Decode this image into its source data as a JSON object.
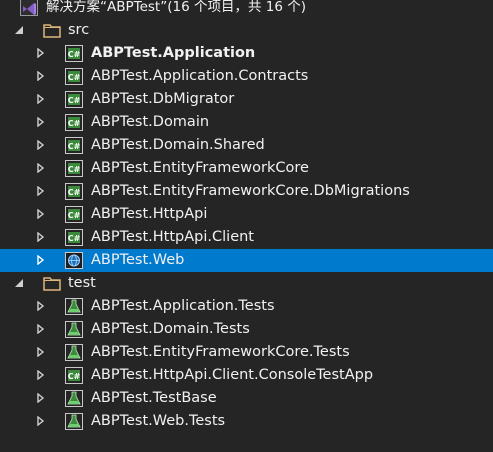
{
  "solution": {
    "label": "解决方案“ABPTest”(16 个项目，共 16 个)",
    "icon": "visual-studio-solution-icon"
  },
  "folders": [
    {
      "name": "src",
      "expanded": true,
      "icon": "folder-icon",
      "projects": [
        {
          "label": "ABPTest.Application",
          "icon": "csharp-project-icon",
          "bold": true
        },
        {
          "label": "ABPTest.Application.Contracts",
          "icon": "csharp-project-icon"
        },
        {
          "label": "ABPTest.DbMigrator",
          "icon": "csharp-project-icon"
        },
        {
          "label": "ABPTest.Domain",
          "icon": "csharp-project-icon"
        },
        {
          "label": "ABPTest.Domain.Shared",
          "icon": "csharp-project-icon"
        },
        {
          "label": "ABPTest.EntityFrameworkCore",
          "icon": "csharp-project-icon"
        },
        {
          "label": "ABPTest.EntityFrameworkCore.DbMigrations",
          "icon": "csharp-project-icon"
        },
        {
          "label": "ABPTest.HttpApi",
          "icon": "csharp-project-icon"
        },
        {
          "label": "ABPTest.HttpApi.Client",
          "icon": "csharp-project-icon"
        },
        {
          "label": "ABPTest.Web",
          "icon": "web-project-icon",
          "selected": true
        }
      ]
    },
    {
      "name": "test",
      "expanded": true,
      "icon": "folder-icon",
      "projects": [
        {
          "label": "ABPTest.Application.Tests",
          "icon": "test-project-icon"
        },
        {
          "label": "ABPTest.Domain.Tests",
          "icon": "test-project-icon"
        },
        {
          "label": "ABPTest.EntityFrameworkCore.Tests",
          "icon": "test-project-icon"
        },
        {
          "label": "ABPTest.HttpApi.Client.ConsoleTestApp",
          "icon": "csharp-project-icon"
        },
        {
          "label": "ABPTest.TestBase",
          "icon": "test-project-icon"
        },
        {
          "label": "ABPTest.Web.Tests",
          "icon": "test-project-icon"
        }
      ]
    }
  ],
  "colors": {
    "background": "#252526",
    "selection": "#007acc",
    "text": "#f1f1f1",
    "folder": "#dcb67a",
    "csharp_green": "#3c8a3c",
    "vs_purple": "#865fc5"
  }
}
